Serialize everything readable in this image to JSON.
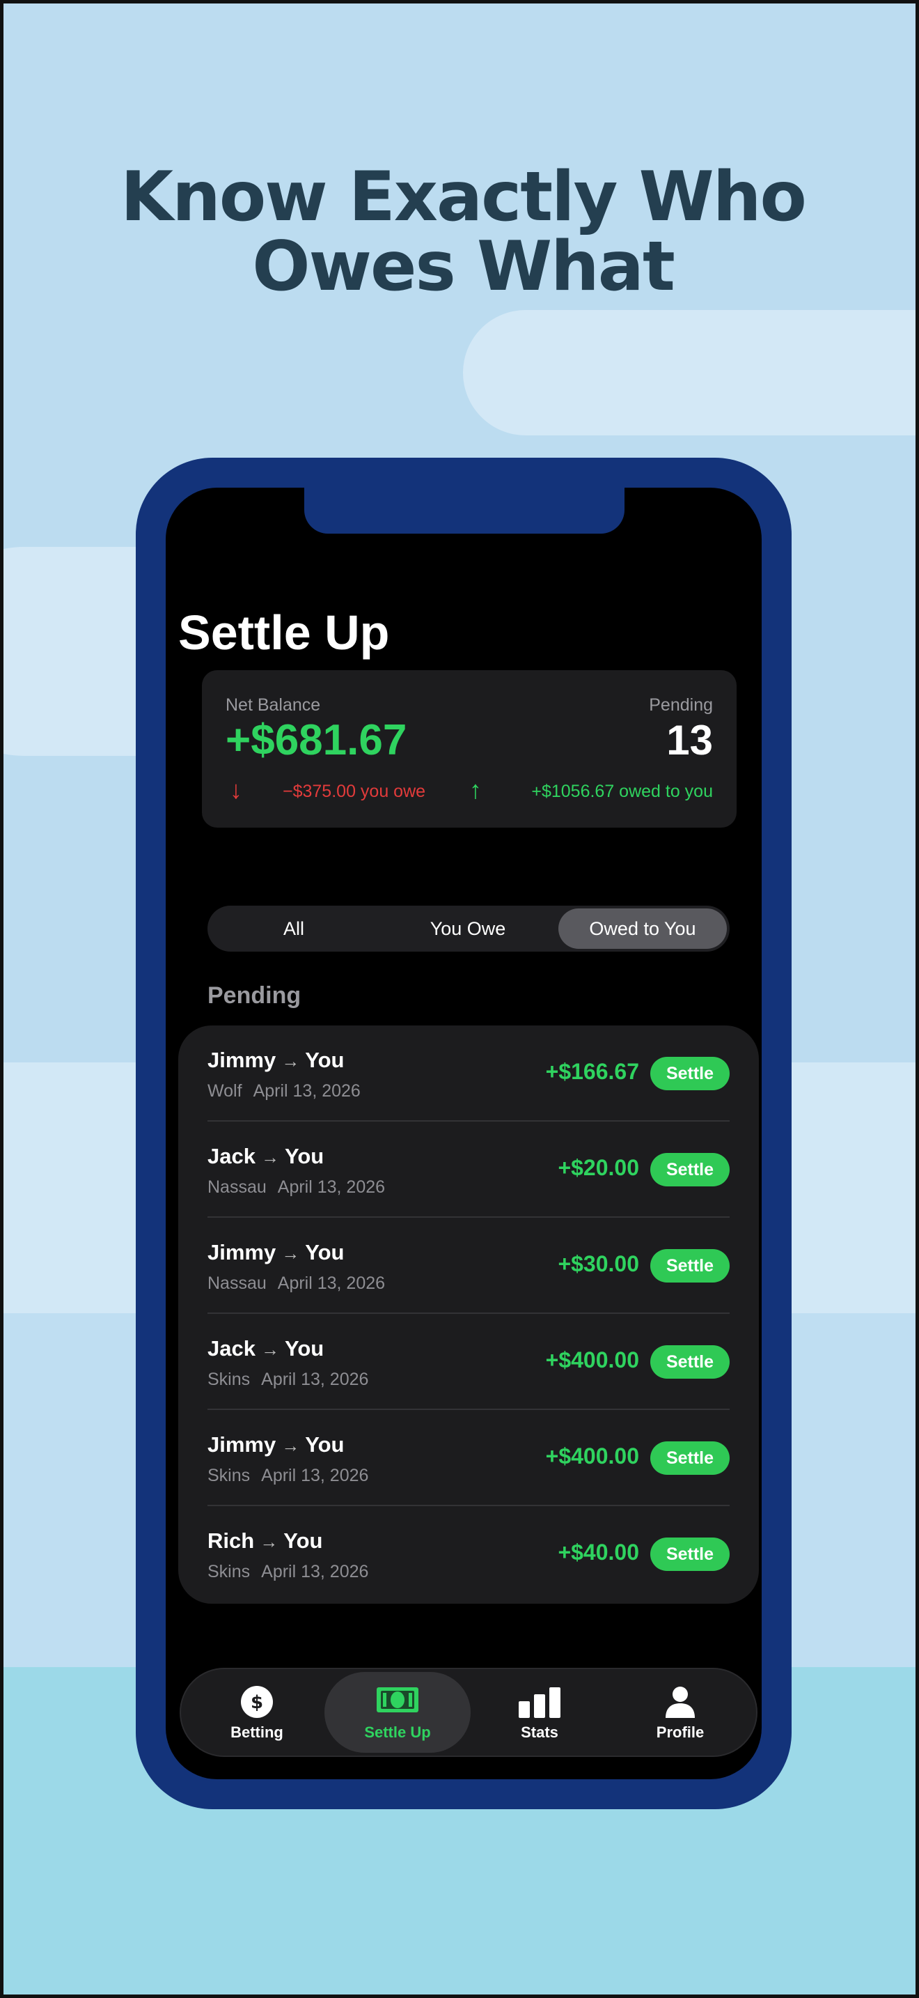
{
  "headline": {
    "line1": "Know Exactly Who",
    "line2": "Owes What"
  },
  "screen": {
    "title": "Settle Up",
    "balance": {
      "net_label": "Net Balance",
      "net_value": "+$681.67",
      "pending_label": "Pending",
      "pending_value": "13",
      "you_owe": "−$375.00 you owe",
      "owed_to_you": "+$1056.67 owed to you"
    },
    "segments": {
      "all": "All",
      "you_owe": "You Owe",
      "owed_to_you": "Owed to You",
      "selected": "Owed to You"
    },
    "section_label": "Pending",
    "settlements": [
      {
        "from": "Jimmy",
        "to": "You",
        "game": "Wolf",
        "date": "April 13, 2026",
        "amount": "+$166.67",
        "action": "Settle"
      },
      {
        "from": "Jack",
        "to": "You",
        "game": "Nassau",
        "date": "April 13, 2026",
        "amount": "+$20.00",
        "action": "Settle"
      },
      {
        "from": "Jimmy",
        "to": "You",
        "game": "Nassau",
        "date": "April 13, 2026",
        "amount": "+$30.00",
        "action": "Settle"
      },
      {
        "from": "Jack",
        "to": "You",
        "game": "Skins",
        "date": "April 13, 2026",
        "amount": "+$400.00",
        "action": "Settle"
      },
      {
        "from": "Jimmy",
        "to": "You",
        "game": "Skins",
        "date": "April 13, 2026",
        "amount": "+$400.00",
        "action": "Settle"
      },
      {
        "from": "Rich",
        "to": "You",
        "game": "Skins",
        "date": "April 13, 2026",
        "amount": "+$40.00",
        "action": "Settle"
      }
    ],
    "tabbar": [
      {
        "label": "Betting",
        "icon": "dollar-coin-icon"
      },
      {
        "label": "Settle Up",
        "icon": "cash-icon"
      },
      {
        "label": "Stats",
        "icon": "bar-chart-icon"
      },
      {
        "label": "Profile",
        "icon": "person-icon"
      }
    ],
    "active_tab": "Settle Up"
  },
  "colors": {
    "positive": "#2fd35f",
    "negative": "#e23b3b",
    "phone_frame": "#13337a",
    "headline": "#243f50"
  }
}
